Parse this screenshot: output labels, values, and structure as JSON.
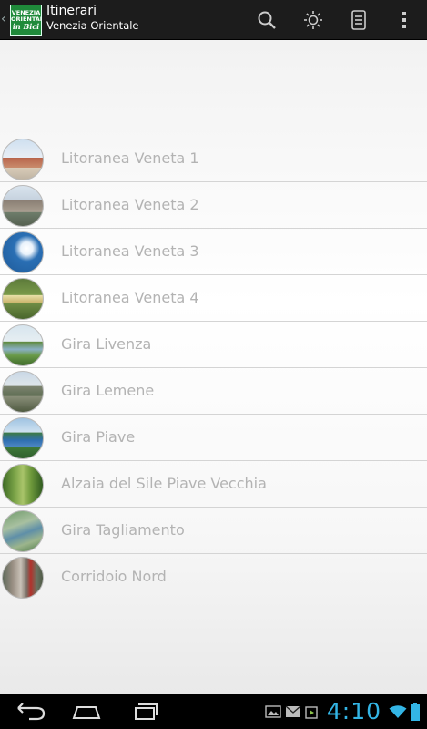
{
  "actionbar": {
    "title": "Itinerari",
    "subtitle": "Venezia Orientale",
    "logo_lines": [
      "VENEZIA",
      "ORIENTALE",
      "in Bici"
    ],
    "actions": [
      {
        "icon": "search-icon"
      },
      {
        "icon": "brightness-icon"
      },
      {
        "icon": "storage-icon"
      },
      {
        "icon": "overflow-menu-icon"
      }
    ]
  },
  "itineraries": [
    {
      "label": "Litoranea Veneta 1"
    },
    {
      "label": "Litoranea Veneta 2"
    },
    {
      "label": "Litoranea Veneta 3"
    },
    {
      "label": "Litoranea Veneta 4"
    },
    {
      "label": "Gira Livenza"
    },
    {
      "label": "Gira Lemene"
    },
    {
      "label": "Gira Piave"
    },
    {
      "label": "Alzaia del Sile Piave Vecchia"
    },
    {
      "label": "Gira Tagliamento"
    },
    {
      "label": "Corridoio Nord"
    }
  ],
  "systembar": {
    "clock": "4:10",
    "nav": [
      "back-icon",
      "home-icon",
      "recent-apps-icon"
    ],
    "status_icons": [
      "gallery-icon",
      "mail-icon",
      "play-store-icon",
      "wifi-icon",
      "battery-icon"
    ],
    "accent_color": "#33b5e5"
  }
}
